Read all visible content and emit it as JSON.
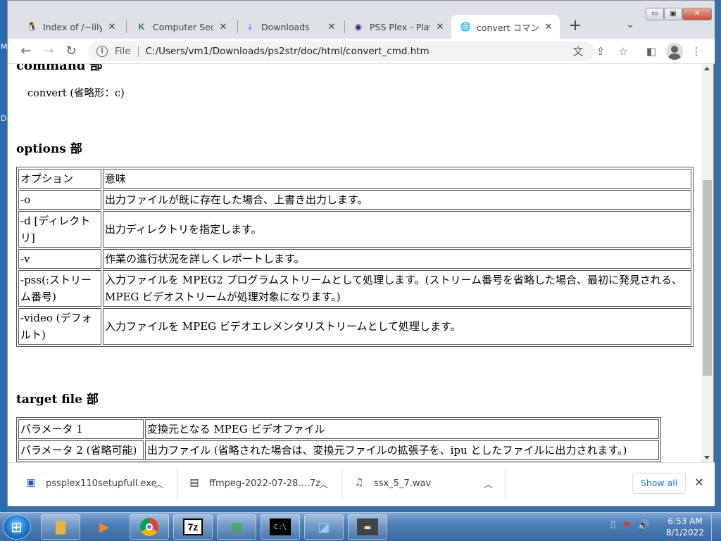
{
  "desktop": {
    "edge_letters": [
      "M",
      "D"
    ]
  },
  "window_controls": {
    "minimize": "▭",
    "restore": "▣",
    "close": "✕"
  },
  "tabs": [
    {
      "label": "Index of /~lily/fil",
      "icon": "tux-icon"
    },
    {
      "label": "Computer Securi",
      "icon": "k-logo-icon"
    },
    {
      "label": "Downloads",
      "icon": "download-icon"
    },
    {
      "label": "PSS Plex - Playst",
      "icon": "pss-plex-icon"
    },
    {
      "label": "convert コマンド",
      "icon": "globe-icon",
      "active": true
    }
  ],
  "toolbar": {
    "scheme": "File",
    "url": "C:/Users/vm1/Downloads/ps2str/doc/html/convert_cmd.htm"
  },
  "page": {
    "command_heading_cut": "command 部",
    "command_text": "convert (省略形：c)",
    "options_heading": "options 部",
    "options_table": {
      "headers": [
        "オプション",
        "意味"
      ],
      "rows": [
        [
          "-o",
          "出力ファイルが既に存在した場合、上書き出力します。"
        ],
        [
          "-d [ディレクトリ]",
          "出力ディレクトリを指定します。"
        ],
        [
          "-v",
          "作業の進行状況を詳しくレポートします。"
        ],
        [
          "-pss(:ストリーム番号)",
          "入力ファイルを MPEG2 プログラムストリームとして処理します。(ストリーム番号を省略した場合、最初に発見される、MPEG ビデオストリームが処理対象になります。)"
        ],
        [
          "-video (デフォルト)",
          "入力ファイルを MPEG ビデオエレメンタリストリームとして処理します。"
        ]
      ]
    },
    "target_heading": "target file 部",
    "target_table": {
      "rows": [
        [
          "パラメータ 1",
          "変換元となる MPEG ビデオファイル"
        ],
        [
          "パラメータ 2 (省略可能)",
          "出力ファイル (省略された場合は、変換元ファイルの拡張子を、ipu としたファイルに出力されます。)"
        ]
      ]
    }
  },
  "downloads": {
    "items": [
      {
        "name": "pssplex110setupfull.exe",
        "icon": "installer-icon"
      },
      {
        "name": "ffmpeg-2022-07-28....7z",
        "icon": "7z-archive-icon"
      },
      {
        "name": "ssx_5_7.wav",
        "icon": "audio-file-icon"
      }
    ],
    "show_all": "Show all"
  },
  "taskbar": {
    "apps": [
      "explorer-icon",
      "media-player-icon",
      "chrome-icon",
      "7zip-icon",
      "installer-app-icon",
      "cmd-icon",
      "notepad-icon",
      "terminal-icon"
    ],
    "clock_time": "6:53 AM",
    "clock_date": "8/1/2022"
  },
  "colors": {
    "accent": "#1a73e8",
    "taskbar": "#4f7fb8"
  }
}
